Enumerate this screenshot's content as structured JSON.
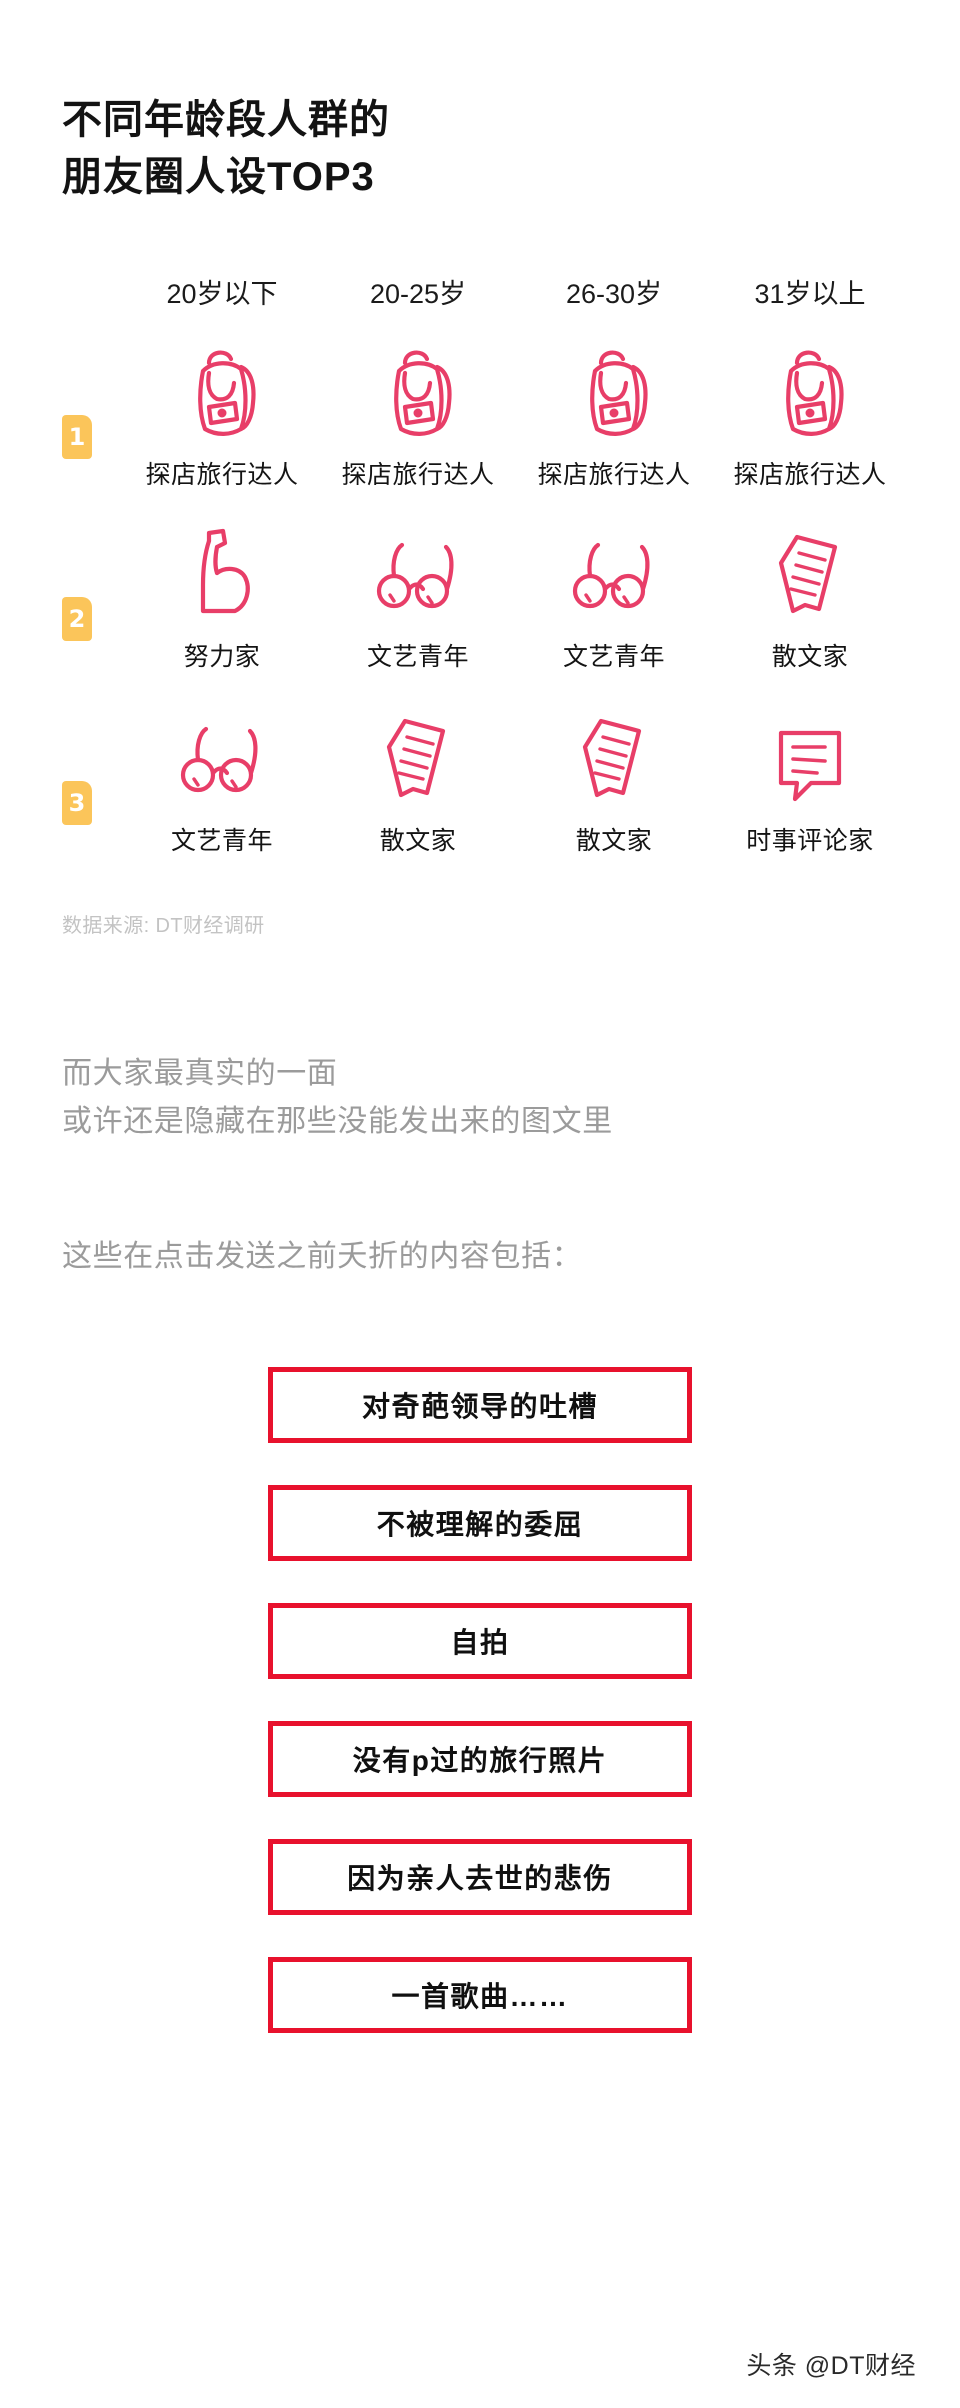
{
  "title": {
    "line1": "不同年龄段人群的",
    "line2": "朋友圈人设TOP3"
  },
  "colors": {
    "icon_pink": "#e83e68",
    "badge_amber": "#fbc55a",
    "box_red": "#e8112d",
    "muted_gray": "#9b9b9b",
    "source_gray": "#c3c3c3"
  },
  "chart_data": {
    "type": "table",
    "title": "不同年龄段人群的朋友圈人设TOP3",
    "categories": [
      "20岁以下",
      "20-25岁",
      "26-30岁",
      "31岁以上"
    ],
    "rank_labels": [
      "1",
      "2",
      "3"
    ],
    "rows": [
      {
        "rank": "1",
        "cells": [
          {
            "label": "探店旅行达人",
            "icon": "backpack-icon"
          },
          {
            "label": "探店旅行达人",
            "icon": "backpack-icon"
          },
          {
            "label": "探店旅行达人",
            "icon": "backpack-icon"
          },
          {
            "label": "探店旅行达人",
            "icon": "backpack-icon"
          }
        ]
      },
      {
        "rank": "2",
        "cells": [
          {
            "label": "努力家",
            "icon": "flexed-biceps-icon"
          },
          {
            "label": "文艺青年",
            "icon": "glasses-icon"
          },
          {
            "label": "文艺青年",
            "icon": "glasses-icon"
          },
          {
            "label": "散文家",
            "icon": "document-icon"
          }
        ]
      },
      {
        "rank": "3",
        "cells": [
          {
            "label": "文艺青年",
            "icon": "glasses-icon"
          },
          {
            "label": "散文家",
            "icon": "document-icon"
          },
          {
            "label": "散文家",
            "icon": "document-icon"
          },
          {
            "label": "时事评论家",
            "icon": "speech-bubble-icon"
          }
        ]
      }
    ]
  },
  "source": "数据来源: DT财经调研",
  "paragraph1": {
    "line1": "而大家最真实的一面",
    "line2": "或许还是隐藏在那些没能发出来的图文里"
  },
  "paragraph2": {
    "line1": "这些在点击发送之前夭折的内容包括："
  },
  "boxes": [
    "对奇葩领导的吐槽",
    "不被理解的委屈",
    "自拍",
    "没有p过的旅行照片",
    "因为亲人去世的悲伤",
    "一首歌曲……"
  ],
  "watermark": "头条 @DT财经"
}
